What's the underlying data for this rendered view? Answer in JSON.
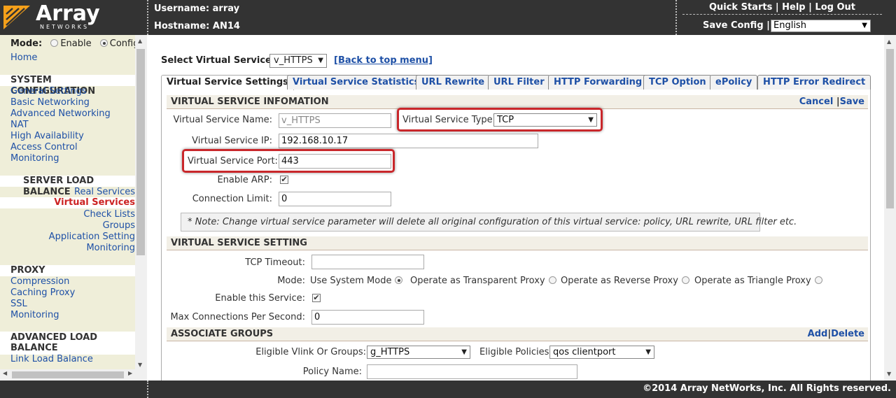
{
  "header": {
    "logo_brand": "Array",
    "logo_sub": "NETWORKS",
    "username_label": "Username: array",
    "hostname_label": "Hostname: AN14",
    "links": [
      "Quick Starts",
      "Help",
      "Log Out"
    ],
    "save_config": "Save Config",
    "language": "English"
  },
  "sidebar": {
    "mode_label": "Mode:",
    "mode_enable": "Enable",
    "mode_config": "Config",
    "home": "Home",
    "system_configuration": {
      "title": "SYSTEM CONFIGURATION",
      "items": [
        "General Settings",
        "Basic Networking",
        "Advanced Networking",
        "NAT",
        "High Availability",
        "Access Control",
        "Monitoring"
      ]
    },
    "server_load_balance": {
      "title": "SERVER LOAD BALANCE",
      "items": [
        "Real Services",
        "Virtual Services",
        "Check Lists",
        "Groups",
        "Application Setting",
        "Monitoring"
      ]
    },
    "proxy": {
      "title": "PROXY",
      "items": [
        "Compression",
        "Caching Proxy",
        "SSL",
        "Monitoring"
      ]
    },
    "advanced_load_balance": {
      "title": "ADVANCED LOAD BALANCE",
      "items": [
        "Link Load Balance"
      ]
    }
  },
  "main": {
    "select_label": "Select Virtual Service:",
    "select_value": "v_HTTPS",
    "back_link": "[Back to top menu]",
    "tabs": [
      "Virtual Service Settings",
      "Virtual Service Statistics",
      "URL Rewrite",
      "URL Filter",
      "HTTP Forwarding",
      "TCP Option",
      "ePolicy",
      "HTTP Error Redirect"
    ],
    "info_section": {
      "title": "VIRTUAL SERVICE INFOMATION",
      "cancel": "Cancel",
      "save": "Save",
      "name_label": "Virtual Service Name:",
      "name_value": "v_HTTPS",
      "type_label": "Virtual Service Type:",
      "type_value": "TCP",
      "ip_label": "Virtual Service IP:",
      "ip_value": "192.168.10.17",
      "port_label": "Virtual Service Port:",
      "port_value": "443",
      "arp_label": "Enable ARP:",
      "conn_limit_label": "Connection Limit:",
      "conn_limit_value": "0",
      "note": "* Note: Change virtual service parameter will delete all original configuration of this virtual service: policy, URL rewrite, URL filter etc."
    },
    "setting_section": {
      "title": "VIRTUAL SERVICE SETTING",
      "tcp_timeout_label": "TCP Timeout:",
      "tcp_timeout_value": "",
      "mode_label": "Mode:",
      "mode_options": [
        "Use System Mode",
        "Operate as Transparent Proxy",
        "Operate as Reverse Proxy",
        "Operate as Triangle Proxy"
      ],
      "enable_label": "Enable this Service:",
      "max_conn_label": "Max Connections Per Second:",
      "max_conn_value": "0"
    },
    "groups_section": {
      "title": "ASSOCIATE GROUPS",
      "add": "Add",
      "delete": "Delete",
      "eligible_label": "Eligible Vlink Or Groups:",
      "eligible_value": "g_HTTPS",
      "policies_label": "Eligible Policies:",
      "policies_value": "qos clientport",
      "policy_name_label": "Policy Name:",
      "policy_name_value": ""
    }
  },
  "footer": {
    "copyright": "©2014 Array NetWorks, Inc. All Rights reserved."
  }
}
